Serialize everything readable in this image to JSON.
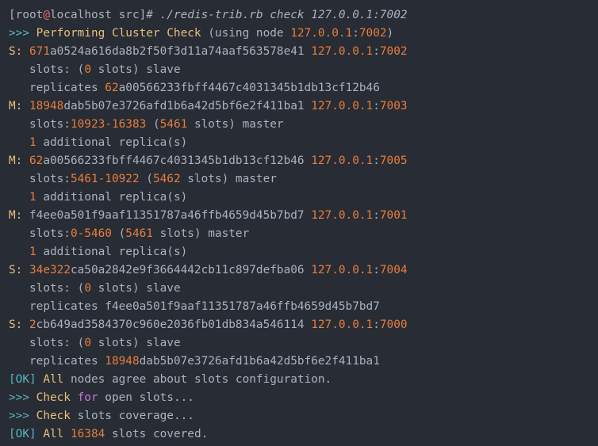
{
  "palette": {
    "background": "#282c34",
    "default": "#abb2bf",
    "number": "#e87d3e",
    "cyan": "#56b6c2",
    "yellow": "#e5c07b",
    "purple": "#c678dd",
    "red": "#e06c75"
  },
  "terminal": {
    "lines": [
      [
        [
          "[root",
          "default"
        ],
        [
          "@",
          "red"
        ],
        [
          "localhost src]",
          "default"
        ],
        [
          "# ./redis-trib.rb check 127.0.0.1:7002",
          "italic"
        ]
      ],
      [
        [
          ">>> ",
          "cyan"
        ],
        [
          "Performing Cluster Check",
          "yellow"
        ],
        [
          " (using node ",
          "default"
        ],
        [
          "127.0.0.1",
          "number"
        ],
        [
          ":",
          "default"
        ],
        [
          "7002",
          "number"
        ],
        [
          ")",
          "default"
        ]
      ],
      [
        [
          "S: ",
          "yellow"
        ],
        [
          "671",
          "number"
        ],
        [
          "a0524a616da8b2f50f3d11a74aaf563578e41 ",
          "default"
        ],
        [
          "127.0.0.1",
          "number"
        ],
        [
          ":",
          "default"
        ],
        [
          "7002",
          "number"
        ]
      ],
      [
        [
          "   slots: (",
          "default"
        ],
        [
          "0",
          "number"
        ],
        [
          " slots) slave",
          "default"
        ]
      ],
      [
        [
          "   replicates ",
          "default"
        ],
        [
          "62",
          "number"
        ],
        [
          "a00566233fbff4467c4031345b1db13cf12b46",
          "default"
        ]
      ],
      [
        [
          "M: ",
          "yellow"
        ],
        [
          "18948",
          "number"
        ],
        [
          "dab5b07e3726afd1b6a42d5bf6e2f411ba1 ",
          "default"
        ],
        [
          "127.0.0.1",
          "number"
        ],
        [
          ":",
          "default"
        ],
        [
          "7003",
          "number"
        ]
      ],
      [
        [
          "   slots:",
          "default"
        ],
        [
          "10923-16383",
          "number"
        ],
        [
          " (",
          "default"
        ],
        [
          "5461",
          "number"
        ],
        [
          " slots) master",
          "default"
        ]
      ],
      [
        [
          "   ",
          "default"
        ],
        [
          "1",
          "number"
        ],
        [
          " additional replica(s)",
          "default"
        ]
      ],
      [
        [
          "M: ",
          "yellow"
        ],
        [
          "62",
          "number"
        ],
        [
          "a00566233fbff4467c4031345b1db13cf12b46 ",
          "default"
        ],
        [
          "127.0.0.1",
          "number"
        ],
        [
          ":",
          "default"
        ],
        [
          "7005",
          "number"
        ]
      ],
      [
        [
          "   slots:",
          "default"
        ],
        [
          "5461-10922",
          "number"
        ],
        [
          " (",
          "default"
        ],
        [
          "5462",
          "number"
        ],
        [
          " slots) master",
          "default"
        ]
      ],
      [
        [
          "   ",
          "default"
        ],
        [
          "1",
          "number"
        ],
        [
          " additional replica(s)",
          "default"
        ]
      ],
      [
        [
          "M: ",
          "yellow"
        ],
        [
          "f4ee0a501f9aaf11351787a46ffb4659d45b7bd7 ",
          "default"
        ],
        [
          "127.0.0.1",
          "number"
        ],
        [
          ":",
          "default"
        ],
        [
          "7001",
          "number"
        ]
      ],
      [
        [
          "   slots:",
          "default"
        ],
        [
          "0-5460",
          "number"
        ],
        [
          " (",
          "default"
        ],
        [
          "5461",
          "number"
        ],
        [
          " slots) master",
          "default"
        ]
      ],
      [
        [
          "   ",
          "default"
        ],
        [
          "1",
          "number"
        ],
        [
          " additional replica(s)",
          "default"
        ]
      ],
      [
        [
          "S: ",
          "yellow"
        ],
        [
          "34e322",
          "number"
        ],
        [
          "ca50a2842e9f3664442cb11c897defba06 ",
          "default"
        ],
        [
          "127.0.0.1",
          "number"
        ],
        [
          ":",
          "default"
        ],
        [
          "7004",
          "number"
        ]
      ],
      [
        [
          "   slots: (",
          "default"
        ],
        [
          "0",
          "number"
        ],
        [
          " slots) slave",
          "default"
        ]
      ],
      [
        [
          "   replicates f4ee0a501f9aaf11351787a46ffb4659d45b7bd7",
          "default"
        ]
      ],
      [
        [
          "S: ",
          "yellow"
        ],
        [
          "2",
          "number"
        ],
        [
          "cb649ad3584370c960e2036fb01db834a546114 ",
          "default"
        ],
        [
          "127.0.0.1",
          "number"
        ],
        [
          ":",
          "default"
        ],
        [
          "7000",
          "number"
        ]
      ],
      [
        [
          "   slots: (",
          "default"
        ],
        [
          "0",
          "number"
        ],
        [
          " slots) slave",
          "default"
        ]
      ],
      [
        [
          "   replicates ",
          "default"
        ],
        [
          "18948",
          "number"
        ],
        [
          "dab5b07e3726afd1b6a42d5bf6e2f411ba1",
          "default"
        ]
      ],
      [
        [
          "[OK] ",
          "cyan"
        ],
        [
          "All",
          "yellow"
        ],
        [
          " nodes agree about slots configuration.",
          "default"
        ]
      ],
      [
        [
          ">>> ",
          "cyan"
        ],
        [
          "Check ",
          "yellow"
        ],
        [
          "for",
          "purple"
        ],
        [
          " open slots...",
          "default"
        ]
      ],
      [
        [
          ">>> ",
          "cyan"
        ],
        [
          "Check",
          "yellow"
        ],
        [
          " slots coverage...",
          "default"
        ]
      ],
      [
        [
          "[OK] ",
          "cyan"
        ],
        [
          "All ",
          "yellow"
        ],
        [
          "16384",
          "number"
        ],
        [
          " slots covered.",
          "default"
        ]
      ]
    ]
  }
}
